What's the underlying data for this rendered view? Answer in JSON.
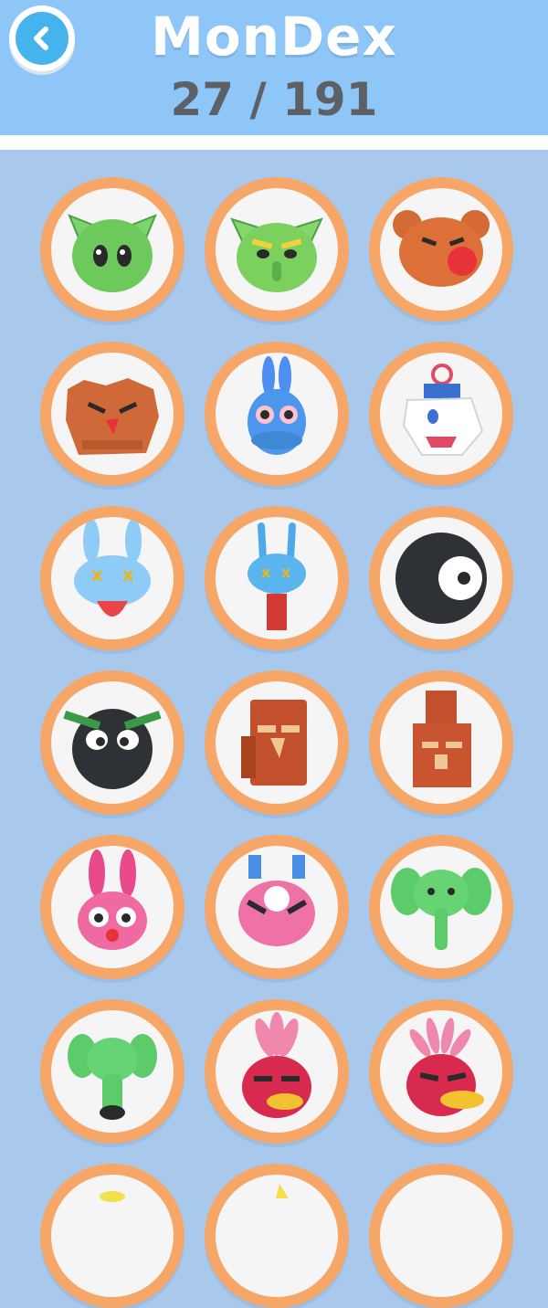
{
  "header": {
    "title": "MonDex",
    "count": "27 / 191",
    "back_icon": "chevron-left-icon"
  },
  "colors": {
    "header_bg": "#8ec6f7",
    "page_bg": "#a9c9ec",
    "slot_ring": "#f6a667",
    "back_button": "#45b3ec"
  },
  "monsters": [
    {
      "name": "green-goblin-monster",
      "icon": "green-goblin-icon"
    },
    {
      "name": "angry-green-goblin-monster",
      "icon": "angry-green-goblin-icon"
    },
    {
      "name": "brown-bear-monster",
      "icon": "brown-bear-icon"
    },
    {
      "name": "angry-rock-bear-monster",
      "icon": "angry-rock-bear-icon"
    },
    {
      "name": "blue-rabbit-monster",
      "icon": "blue-rabbit-icon"
    },
    {
      "name": "white-robot-dragon-monster",
      "icon": "white-robot-dragon-icon"
    },
    {
      "name": "blue-dizzy-bunny-monster",
      "icon": "blue-dizzy-bunny-icon"
    },
    {
      "name": "blue-dizzy-beetle-monster",
      "icon": "blue-dizzy-beetle-icon"
    },
    {
      "name": "black-eyeball-monster",
      "icon": "black-eyeball-icon"
    },
    {
      "name": "black-blob-monster",
      "icon": "black-blob-icon"
    },
    {
      "name": "brick-golem-monster",
      "icon": "brick-golem-icon"
    },
    {
      "name": "brick-tower-golem-monster",
      "icon": "brick-tower-golem-icon"
    },
    {
      "name": "pink-bunny-monster",
      "icon": "pink-bunny-icon"
    },
    {
      "name": "pink-bug-monster",
      "icon": "pink-bug-icon"
    },
    {
      "name": "green-elephant-monster",
      "icon": "green-elephant-icon"
    },
    {
      "name": "green-elephant-trunk-monster",
      "icon": "green-elephant-trunk-icon"
    },
    {
      "name": "red-bird-monster",
      "icon": "red-bird-icon"
    },
    {
      "name": "red-crested-bird-monster",
      "icon": "red-crested-bird-icon"
    },
    {
      "name": "partial-monster-1",
      "icon": "monster-icon"
    },
    {
      "name": "partial-monster-2",
      "icon": "monster-icon"
    },
    {
      "name": "partial-monster-3",
      "icon": "monster-icon"
    }
  ]
}
